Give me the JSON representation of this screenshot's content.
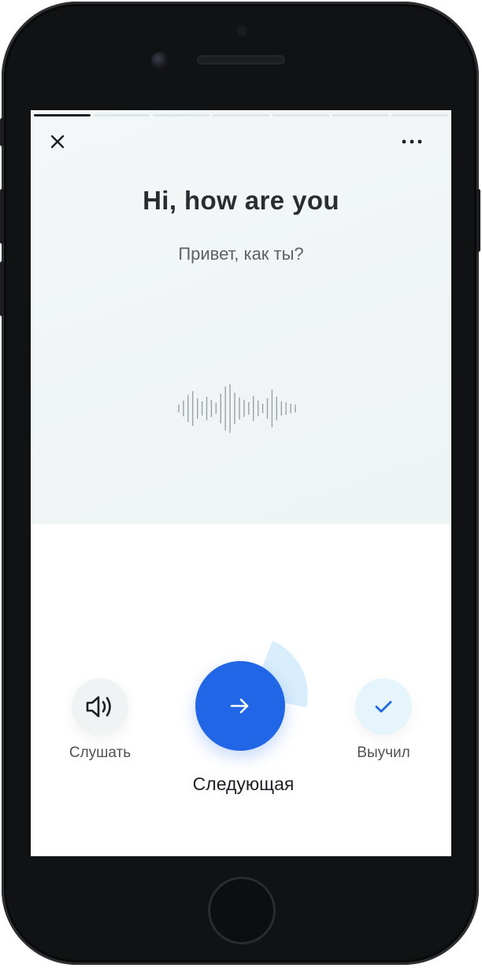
{
  "card": {
    "progress": {
      "total_steps": 7,
      "current_step": 1
    },
    "phrase": "Hi, how are you",
    "translation": "Привет, как ты?"
  },
  "actions": {
    "listen_label": "Слушать",
    "next_label": "Следующая",
    "learned_label": "Выучил"
  },
  "icons": {
    "close": "close-icon",
    "more": "more-dots-icon",
    "waveform": "audio-waveform-icon",
    "speaker": "speaker-icon",
    "arrow": "arrow-right-icon",
    "check": "check-icon"
  },
  "colors": {
    "accent": "#2166e6",
    "accent_light": "#d9eefc",
    "card_background": "#eef3f4",
    "text_primary": "#2a2c31",
    "text_secondary": "#5e6166"
  }
}
